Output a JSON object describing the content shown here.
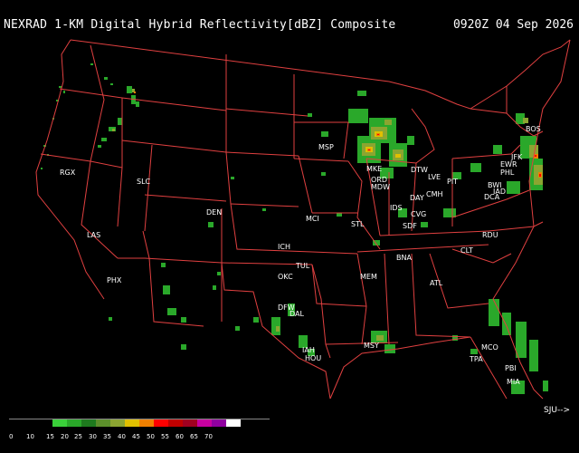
{
  "header": {
    "title": "NEXRAD 1-KM Digital Hybrid Reflectivity[dBZ] Composite",
    "timestamp": "0920Z 04 Sep 2026"
  },
  "legend": {
    "labels": [
      "0",
      "10",
      "15",
      "20",
      "25",
      "30",
      "35",
      "40",
      "45",
      "50",
      "55",
      "60",
      "65",
      "70"
    ],
    "colors": [
      "#000000",
      "#000000",
      "#3ad03a",
      "#2aa82a",
      "#1e7a1e",
      "#5c8f2b",
      "#8ba531",
      "#e0c000",
      "#f08000",
      "#ff0000",
      "#c00000",
      "#a00020",
      "#c800a0",
      "#9000a0",
      "#ffffff"
    ]
  },
  "nav": {
    "label": "SJU-->"
  },
  "cities": [
    {
      "code": "RGX"
    },
    {
      "code": "SLC"
    },
    {
      "code": "LAS"
    },
    {
      "code": "PHX"
    },
    {
      "code": "DEN"
    },
    {
      "code": "ICH"
    },
    {
      "code": "MCI"
    },
    {
      "code": "OKC"
    },
    {
      "code": "TUL"
    },
    {
      "code": "DFW"
    },
    {
      "code": "DAL"
    },
    {
      "code": "IAH"
    },
    {
      "code": "HOU"
    },
    {
      "code": "MSP"
    },
    {
      "code": "MKE"
    },
    {
      "code": "ORD"
    },
    {
      "code": "MDW"
    },
    {
      "code": "DTW"
    },
    {
      "code": "STL"
    },
    {
      "code": "IDS"
    },
    {
      "code": "DAY"
    },
    {
      "code": "CMH"
    },
    {
      "code": "CVG"
    },
    {
      "code": "SDF"
    },
    {
      "code": "LVE"
    },
    {
      "code": "PIT"
    },
    {
      "code": "BNA"
    },
    {
      "code": "MEM"
    },
    {
      "code": "ATL"
    },
    {
      "code": "CLT"
    },
    {
      "code": "RDU"
    },
    {
      "code": "MSY"
    },
    {
      "code": "TPA"
    },
    {
      "code": "MCO"
    },
    {
      "code": "PBI"
    },
    {
      "code": "MIA"
    },
    {
      "code": "BOS"
    },
    {
      "code": "JFK"
    },
    {
      "code": "EWR"
    },
    {
      "code": "PHL"
    },
    {
      "code": "BWI"
    },
    {
      "code": "IAD"
    },
    {
      "code": "DCA"
    }
  ]
}
